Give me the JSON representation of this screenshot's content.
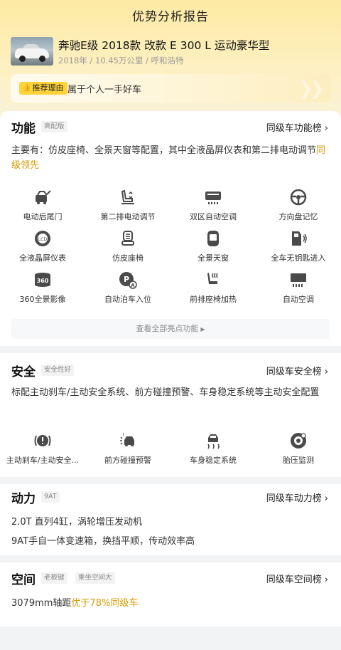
{
  "header": {
    "title": "优势分析报告"
  },
  "car": {
    "name": "奔驰E级 2018款 改款 E 300 L 运动豪华型",
    "meta": "2018年 / 10.45万公里 / 呼和浩特"
  },
  "reason": {
    "tag_icon": "thumbs-up-icon",
    "tag_label": "推荐理由",
    "text": "属于个人一手好车"
  },
  "function": {
    "title": "功能",
    "badge": "高配版",
    "link": "同级车功能榜",
    "desc_main": "主要有：仿皮座椅、全景天窗等配置，其中全液晶屏仪表和第二排电动调节",
    "desc_highlight": "同级领先",
    "features": [
      {
        "icon": "power-tailgate-icon",
        "label": "电动后尾门"
      },
      {
        "icon": "power-seat-adjust-icon",
        "label": "第二排电动调节"
      },
      {
        "icon": "dual-zone-ac-icon",
        "label": "双区自动空调"
      },
      {
        "icon": "steering-wheel-icon",
        "label": "方向盘记忆"
      },
      {
        "icon": "lcd-cluster-icon",
        "label": "全液晶屏仪表"
      },
      {
        "icon": "leather-seat-icon",
        "label": "仿皮座椅"
      },
      {
        "icon": "panoramic-sunroof-icon",
        "label": "全景天窗"
      },
      {
        "icon": "keyless-entry-icon",
        "label": "全车无钥匙进入"
      },
      {
        "icon": "camera-360-icon",
        "label": "360全景影像"
      },
      {
        "icon": "auto-parking-icon",
        "label": "自动泊车入位"
      },
      {
        "icon": "seat-heating-icon",
        "label": "前排座椅加热"
      },
      {
        "icon": "auto-ac-icon",
        "label": "自动空调"
      }
    ],
    "more": "查看全部亮点功能"
  },
  "safety": {
    "title": "安全",
    "badge": "安全性好",
    "link": "同级车安全榜",
    "desc": "标配主动刹车/主动安全系统、前方碰撞预警、车身稳定系统等主动安全配置",
    "features": [
      {
        "icon": "active-brake-icon",
        "label": "主动刹车/主动安全..."
      },
      {
        "icon": "collision-warning-icon",
        "label": "前方碰撞预警"
      },
      {
        "icon": "stability-control-icon",
        "label": "车身稳定系统"
      },
      {
        "icon": "tire-pressure-icon",
        "label": "胎压监测"
      }
    ]
  },
  "power": {
    "title": "动力",
    "badge": "9AT",
    "link": "同级车动力榜",
    "line1": "2.0T 直列4缸，涡轮增压发动机",
    "line2": "9AT手自一体变速箱，换挡平顺，传动效率高"
  },
  "space": {
    "title": "空间",
    "badge1": "老板键",
    "badge2": "乘坐空间大",
    "link": "同级车空间榜",
    "line_main": "3079mm轴距",
    "line_highlight": "优于78%同级车"
  },
  "colors": {
    "highlight": "#d89a00",
    "tag_yellow": "#ffd43a",
    "icon": "#4a4a4a"
  }
}
